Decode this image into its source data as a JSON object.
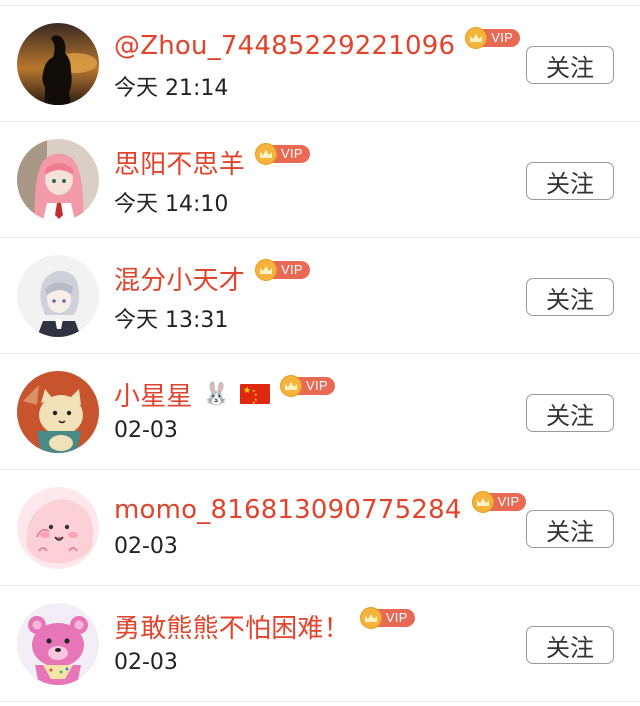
{
  "follow_label": "关注",
  "vip_label": "VIP",
  "colors": {
    "name": "#e0442c",
    "vip_badge": "#e86a55",
    "crown": "#f4b43c"
  },
  "users": [
    {
      "name": "@Zhou_74485229221096",
      "time": "今天 21:14",
      "avatar": "silhouette-sunset"
    },
    {
      "name": "思阳不思羊",
      "time": "今天 14:10",
      "avatar": "anime-girl-pink-hair"
    },
    {
      "name": "混分小天才",
      "time": "今天 13:31",
      "avatar": "anime-boy-white-hair"
    },
    {
      "name": "小星星",
      "emoji": "🐰",
      "flag": "china-flag-icon",
      "time": "02-03",
      "avatar": "cartoon-cat-orange"
    },
    {
      "name": "momo_816813090775284",
      "time": "02-03",
      "avatar": "pink-blob-face"
    },
    {
      "name": "勇敢熊熊不怕困难！",
      "time": "02-03",
      "avatar": "pink-bear"
    }
  ]
}
